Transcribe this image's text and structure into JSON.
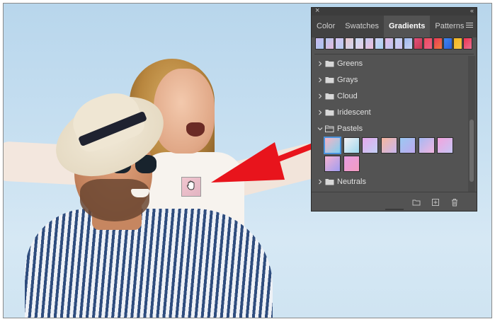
{
  "panel": {
    "tabs": [
      {
        "label": "Color",
        "active": false
      },
      {
        "label": "Swatches",
        "active": false
      },
      {
        "label": "Gradients",
        "active": true
      },
      {
        "label": "Patterns",
        "active": false
      }
    ],
    "preset_colors": [
      [
        "#c9b8ef",
        "#a9c7ee"
      ],
      [
        "#b6c7ef",
        "#e5b9de"
      ],
      [
        "#d9c3f3",
        "#b5cdf0"
      ],
      [
        "#e9c6ce",
        "#cfd6ef"
      ],
      [
        "#c7d8f3",
        "#e7cfe6"
      ],
      [
        "#c3c8f1",
        "#f0c0da"
      ],
      [
        "#cfd0f4",
        "#a8d3f1"
      ],
      [
        "#e4b9e6",
        "#bac8f1"
      ],
      [
        "#bfd4f5",
        "#d1c0ef"
      ],
      [
        "#9fb8ee",
        "#c9d2f3"
      ],
      [
        "#e5507a",
        "#c23a52"
      ],
      [
        "#f04c5c",
        "#e85f88"
      ],
      [
        "#ea3a5a",
        "#f07a3a"
      ],
      [
        "#3f86ef",
        "#2a5fd8"
      ],
      [
        "#f4b521",
        "#f4c64a"
      ],
      [
        "#ef3550",
        "#e87093"
      ]
    ],
    "folders_before": [
      {
        "label": "Greens",
        "expanded": false
      },
      {
        "label": "Grays",
        "expanded": false
      },
      {
        "label": "Cloud",
        "expanded": false
      },
      {
        "label": "Iridescent",
        "expanded": false
      },
      {
        "label": "Pastels",
        "expanded": true
      }
    ],
    "pastel_swatches": [
      {
        "from": "#f6b3c4",
        "to": "#7fd0f1",
        "selected": true
      },
      {
        "from": "#f3f0f4",
        "to": "#9fd9ef",
        "selected": false
      },
      {
        "from": "#e6a8ec",
        "to": "#c2d0f6",
        "selected": false
      },
      {
        "from": "#f5b59d",
        "to": "#c9b7ef",
        "selected": false
      },
      {
        "from": "#9ac8f2",
        "to": "#bfa9ef",
        "selected": false
      },
      {
        "from": "#a6b8f2",
        "to": "#f2b6e0",
        "selected": false
      },
      {
        "from": "#f3a3dd",
        "to": "#c6c6f6",
        "selected": false
      },
      {
        "from": "#f6b2d2",
        "to": "#9f9df0",
        "selected": false
      },
      {
        "from": "#e79ce1",
        "to": "#f29cc0",
        "selected": false
      }
    ],
    "folders_after": [
      {
        "label": "Neutrals",
        "expanded": false
      }
    ],
    "icons": {
      "close": "close-icon",
      "collapse": "collapse-icon",
      "menu": "panel-menu-icon",
      "new_group": "new-group-folder-icon",
      "new_gradient": "new-gradient-icon",
      "delete": "trash-icon"
    }
  },
  "accents": {
    "arrow": "#e8141c",
    "selection": "#4a92dc"
  },
  "drag": {
    "ghost_gradient": [
      "#f1c6cf",
      "#e2b4c2"
    ],
    "cursor": "grab-hand-cursor"
  }
}
